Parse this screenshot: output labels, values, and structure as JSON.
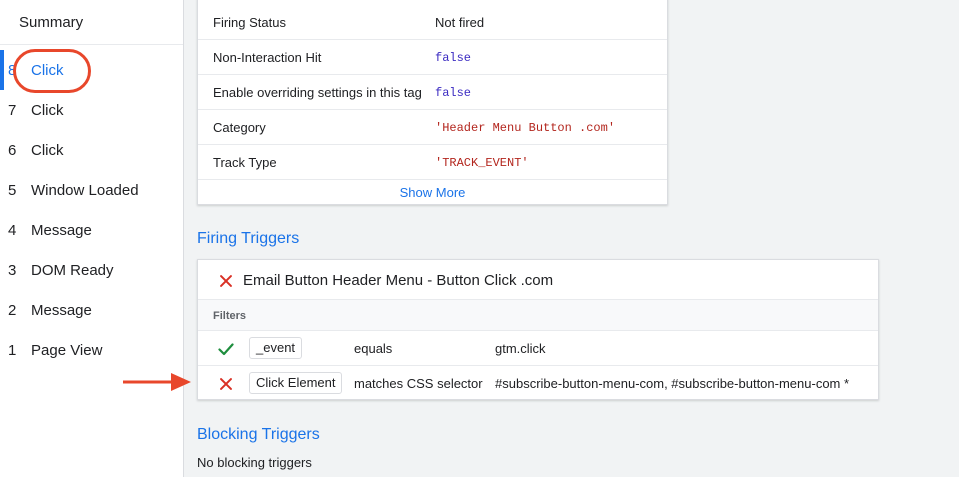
{
  "sidebar": {
    "summary": "Summary",
    "items": [
      {
        "num": "8",
        "label": "Click"
      },
      {
        "num": "7",
        "label": "Click"
      },
      {
        "num": "6",
        "label": "Click"
      },
      {
        "num": "5",
        "label": "Window Loaded"
      },
      {
        "num": "4",
        "label": "Message"
      },
      {
        "num": "3",
        "label": "DOM Ready"
      },
      {
        "num": "2",
        "label": "Message"
      },
      {
        "num": "1",
        "label": "Page View"
      }
    ]
  },
  "properties": {
    "rows": [
      {
        "key": "Firing Status",
        "value": "Not fired"
      },
      {
        "key": "Non-Interaction Hit",
        "value": "false"
      },
      {
        "key": "Enable overriding settings in this tag",
        "value": "false"
      },
      {
        "key": "Category",
        "value": "'Header Menu Button .com'"
      },
      {
        "key": "Track Type",
        "value": "'TRACK_EVENT'"
      }
    ],
    "show_more": "Show More"
  },
  "firing_triggers": {
    "title": "Firing Triggers",
    "trigger_name": "Email Button Header Menu - Button Click .com",
    "filters_label": "Filters",
    "filters": [
      {
        "status": "pass",
        "variable": "_event",
        "operator": "equals",
        "value": "gtm.click"
      },
      {
        "status": "fail",
        "variable": "Click Element",
        "operator": "matches CSS selector",
        "value": "#subscribe-button-menu-com, #subscribe-button-menu-com *"
      }
    ]
  },
  "blocking_triggers": {
    "title": "Blocking Triggers",
    "empty_text": "No blocking triggers"
  },
  "colors": {
    "accent": "#1a73e8",
    "fail": "#d93025",
    "pass": "#1e8e3e",
    "annotation": "#e8472b"
  }
}
